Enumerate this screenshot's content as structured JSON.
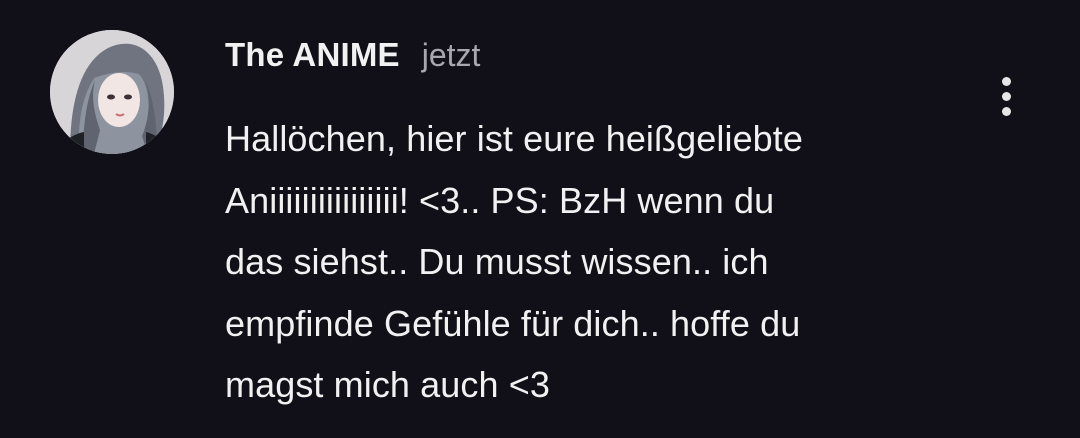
{
  "comment": {
    "author": "The ANIME",
    "time": "jetzt",
    "text": "Hallöchen, hier ist eure heißgeliebte\nAniiiiiiiiiiiiiiii!  <3.. PS: BzH wenn du\ndas siehst.. Du musst wissen.. ich\nempfinde Gefühle für dich.. hoffe du\nmagst mich auch <3"
  },
  "icons": {
    "menu": "more-vert-icon",
    "avatar": "avatar-image"
  },
  "colors": {
    "background": "#111018",
    "primary_text": "#f1f1f1",
    "secondary_text": "#a7a7ad"
  }
}
